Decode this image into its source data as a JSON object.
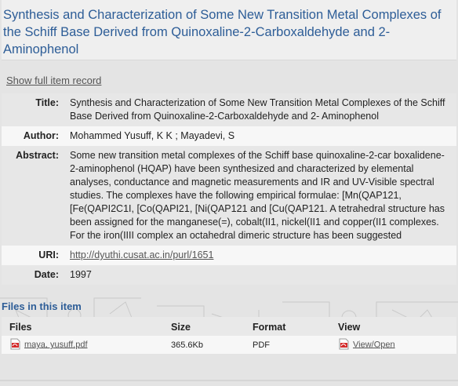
{
  "item": {
    "heading": "Synthesis and Characterization of Some New Transition Metal Complexes of the Schiff Base Derived from Quinoxaline-2-Carboxaldehyde and 2-Aminophenol",
    "show_full_label": "Show full item record"
  },
  "metadata": {
    "title_label": "Title:",
    "title_value": "Synthesis and Characterization of Some New Transition Metal Complexes of the Schiff Base Derived from Quinoxaline-2-Carboxaldehyde and 2- Aminophenol",
    "author_label": "Author:",
    "author_value": "Mohammed Yusuff, K K ; Mayadevi, S",
    "abstract_label": "Abstract:",
    "abstract_value": "Some new transition metal complexes of the Schiff base quinoxaline-2-car boxalidene-2-aminophenol (HQAP) have been synthesized and characterized by elemental analyses, conductance and magnetic measurements and IR and UV-Visible spectral studies. The complexes have the following empirical formulae: [Mn(QAP121, [Fe(QAPI2C1I, [Co(QAPI21, [Ni(QAP121 and [Cu(QAP121. A tetrahedral structure has been assigned for the manganese(=), cobalt(II1, nickel(II1 and copper(II1 complexes. For the iron(IIII complex an octahedral dimeric structure has been suggested",
    "uri_label": "URI:",
    "uri_value": "http://dyuthi.cusat.ac.in/purl/1651",
    "date_label": "Date:",
    "date_value": "1997"
  },
  "files": {
    "heading": "Files in this item",
    "columns": [
      "Files",
      "Size",
      "Format",
      "View"
    ],
    "rows": [
      {
        "name": "maya, yusuff.pdf",
        "size": "365.6Kb",
        "format": "PDF",
        "view": "View/Open",
        "icon": "pdf-icon"
      }
    ]
  },
  "colors": {
    "heading_blue": "#2d5d97",
    "background": "#e4e4e4"
  }
}
